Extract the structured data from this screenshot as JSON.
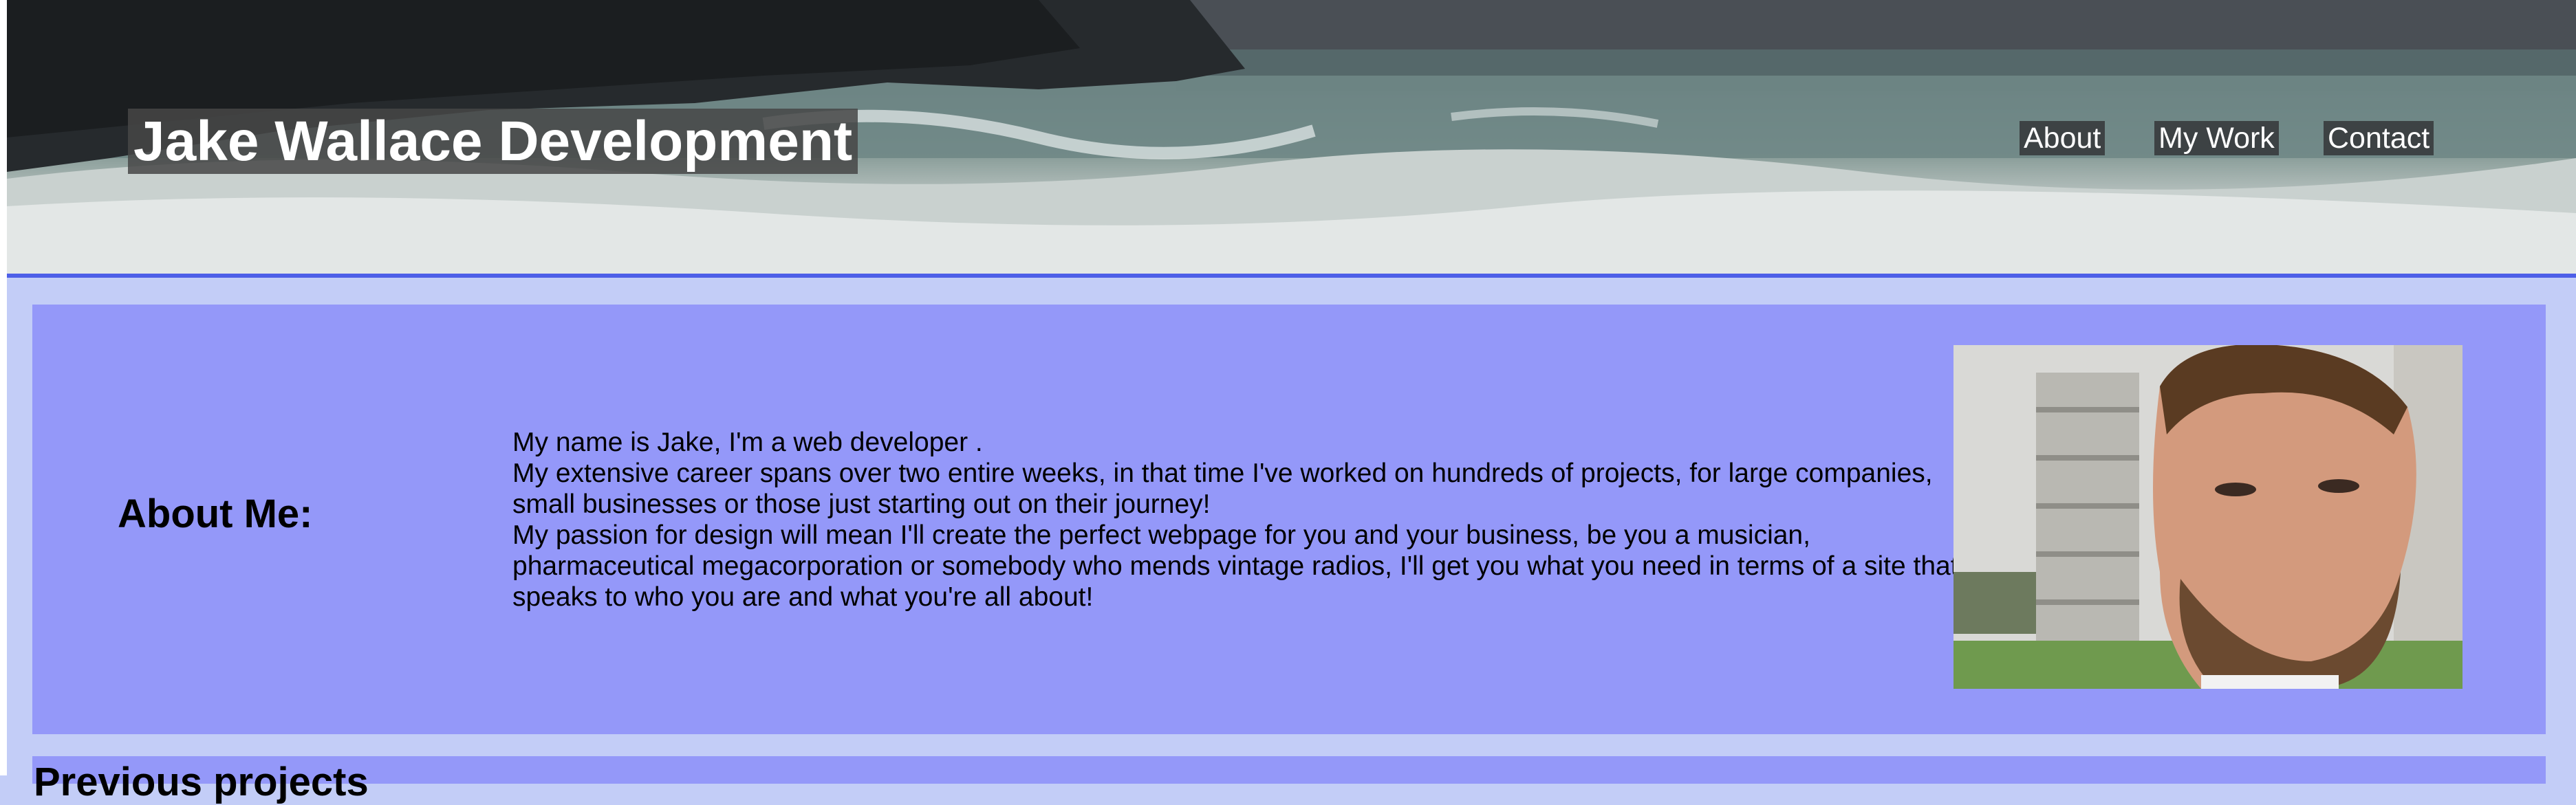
{
  "header": {
    "title": "Jake Wallace Development",
    "nav": [
      {
        "label": "About"
      },
      {
        "label": "My Work"
      },
      {
        "label": "Contact"
      }
    ],
    "accent_border": "#4d5fe8"
  },
  "about": {
    "heading": "About Me:",
    "paragraphs": [
      "My name is Jake, I'm a web developer .",
      "My extensive career spans over two entire weeks, in that time I've worked on hundreds of projects, for large companies, small businesses or those just starting out on their journey!",
      "My passion for design will mean I'll create the perfect webpage for you and your business, be you a musician, pharmaceutical megacorporation or somebody who mends vintage radios, I'll get you what you need in terms of a site that speaks to who you are and what you're all about!"
    ],
    "background": "#9498f9"
  },
  "projects": {
    "heading": "Previous projects"
  },
  "colors": {
    "page_background": "#c3cdf7",
    "panel": "#9498f9"
  }
}
